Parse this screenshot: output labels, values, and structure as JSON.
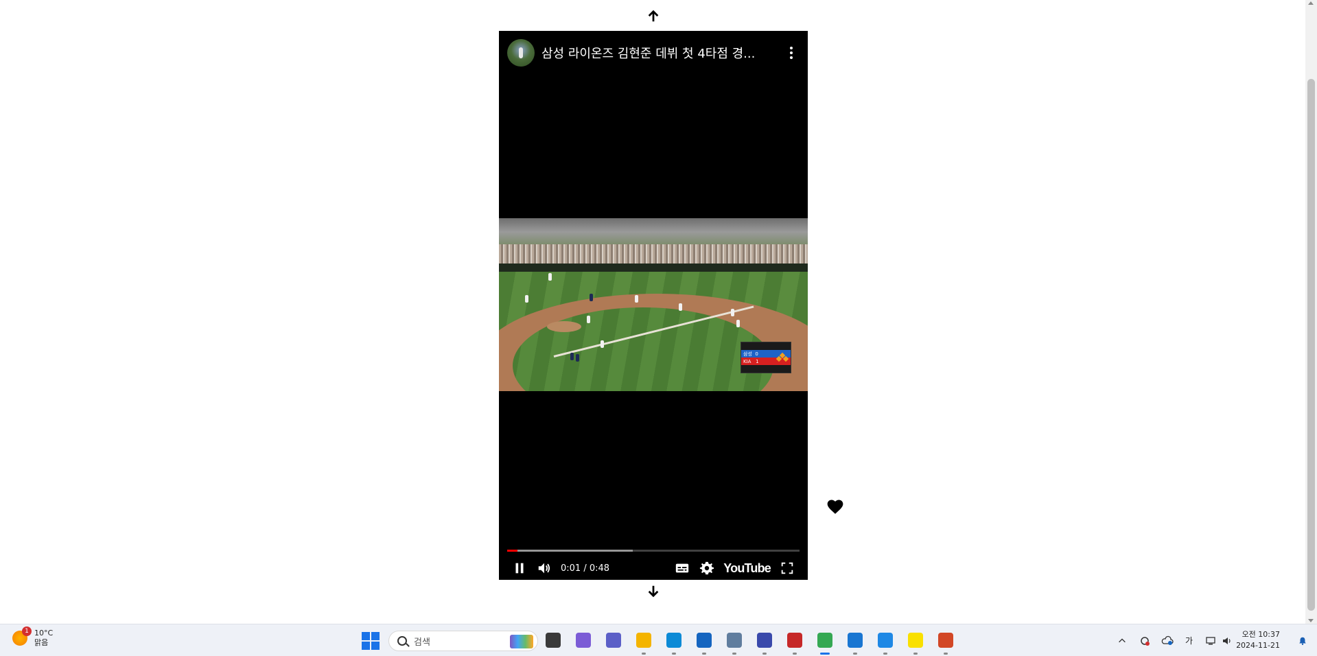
{
  "video": {
    "title": "삼성 라이온즈 김현준 데뷔 첫 4타점 경...",
    "time_current": "0:01",
    "time_total": "0:48",
    "time_display": "0:01 / 0:48",
    "progress_played_fraction": 0.035,
    "progress_buffered_fraction": 0.43,
    "youtube_label": "YouTube"
  },
  "scoreboard": {
    "team1": "삼성",
    "team1_score": "0",
    "team2": "KIA",
    "team2_score": "1"
  },
  "icons": {
    "nav_up": "arrow-up-icon",
    "nav_down": "arrow-down-icon",
    "like": "heart-icon",
    "more": "more-vertical-icon",
    "pause": "pause-icon",
    "volume": "volume-icon",
    "captions": "captions-icon",
    "settings": "gear-icon",
    "fullscreen": "fullscreen-icon"
  },
  "taskbar": {
    "weather_badge": "1",
    "weather_temp": "10°C",
    "weather_desc": "맑음",
    "search_placeholder": "검색",
    "ime_label": "가",
    "clock_period": "오전 10:37",
    "clock_date": "2024-11-21",
    "apps": [
      {
        "name": "file-explorer-window",
        "color": "#3a3a3a"
      },
      {
        "name": "copilot",
        "color": "#7b5cd6"
      },
      {
        "name": "teams",
        "color": "#5b5fc7"
      },
      {
        "name": "file-explorer",
        "color": "#f4b400"
      },
      {
        "name": "edge",
        "color": "#0c8ad6"
      },
      {
        "name": "store",
        "color": "#1565c0"
      },
      {
        "name": "settings-app",
        "color": "#607d9e"
      },
      {
        "name": "cortana-app",
        "color": "#3949ab"
      },
      {
        "name": "mcafee",
        "color": "#c62828"
      },
      {
        "name": "chrome",
        "color": "#34a853"
      },
      {
        "name": "vscode",
        "color": "#1976d2"
      },
      {
        "name": "photos",
        "color": "#1e88e5"
      },
      {
        "name": "kakaotalk",
        "color": "#f9e000"
      },
      {
        "name": "powerpoint",
        "color": "#d24726"
      }
    ]
  },
  "colors": {
    "progress_played": "#ff0000",
    "accent": "#1a73e8"
  }
}
